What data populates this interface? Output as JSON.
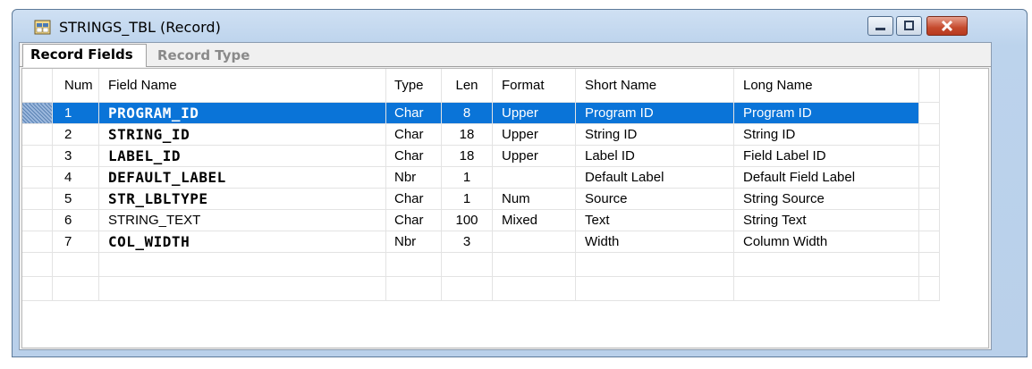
{
  "window": {
    "title": "STRINGS_TBL (Record)",
    "app_icon": "record-icon",
    "controls": [
      "minimize-icon",
      "maximize-icon",
      "close-icon"
    ]
  },
  "tabs": [
    {
      "label": "Record Fields",
      "active": true
    },
    {
      "label": "Record Type",
      "active": false
    }
  ],
  "columns": {
    "num": "Num",
    "field_name": "Field Name",
    "type": "Type",
    "len": "Len",
    "format": "Format",
    "short_name": "Short Name",
    "long_name": "Long Name"
  },
  "rows": [
    {
      "num": "1",
      "field_name": "PROGRAM_ID",
      "type": "Char",
      "len": "8",
      "format": "Upper",
      "short_name": "Program ID",
      "long_name": "Program ID",
      "key": true,
      "selected": true
    },
    {
      "num": "2",
      "field_name": "STRING_ID",
      "type": "Char",
      "len": "18",
      "format": "Upper",
      "short_name": "String ID",
      "long_name": "String ID",
      "key": true
    },
    {
      "num": "3",
      "field_name": "LABEL_ID",
      "type": "Char",
      "len": "18",
      "format": "Upper",
      "short_name": "Label ID",
      "long_name": "Field Label ID",
      "key": true
    },
    {
      "num": "4",
      "field_name": "DEFAULT_LABEL",
      "type": "Nbr",
      "len": "1",
      "format": "",
      "short_name": "Default Label",
      "long_name": "Default Field Label",
      "key": true
    },
    {
      "num": "5",
      "field_name": "STR_LBLTYPE",
      "type": "Char",
      "len": "1",
      "format": "Num",
      "short_name": "Source",
      "long_name": "String Source",
      "key": true
    },
    {
      "num": "6",
      "field_name": "STRING_TEXT",
      "type": "Char",
      "len": "100",
      "format": "Mixed",
      "short_name": "Text",
      "long_name": "String Text",
      "key": false
    },
    {
      "num": "7",
      "field_name": "COL_WIDTH",
      "type": "Nbr",
      "len": "3",
      "format": "",
      "short_name": "Width",
      "long_name": "Column Width",
      "key": true
    }
  ],
  "colors": {
    "selection": "#0a74d8",
    "title_gradient": "#bcd3ec",
    "close_button": "#c54a2d"
  }
}
